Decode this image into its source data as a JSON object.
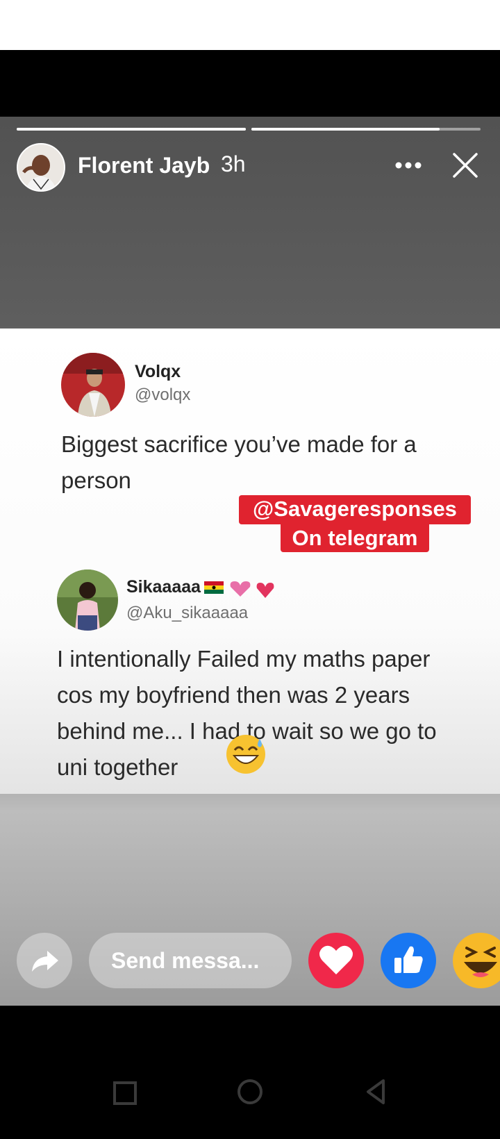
{
  "story": {
    "author": "Florent Jayb",
    "time": "3h",
    "progress": [
      1.0,
      0.82
    ]
  },
  "post": {
    "tweet1": {
      "name": "Volqx",
      "handle": "@volqx",
      "text_line1": "Biggest sacrifice you’ve made for a",
      "text_line2": "person"
    },
    "watermark": {
      "line1": "@Savageresponses",
      "line2": "On telegram"
    },
    "tweet2": {
      "name": "Sikaaaaa",
      "handle": "@Aku_sikaaaaa",
      "text_line1": "I intentionally Failed my maths paper",
      "text_line2": "cos my boyfriend then was  2 years",
      "text_line3": "behind me... I had to wait so  we go to",
      "text_line4": "uni together"
    }
  },
  "actions": {
    "message_placeholder": "Send messa...",
    "icons": [
      "share-icon",
      "heart-reaction-icon",
      "like-reaction-icon",
      "haha-reaction-icon"
    ]
  },
  "colors": {
    "heart": "#f0284a",
    "like": "#1877f2",
    "haha": "#f7b928",
    "watermark": "#e0232f"
  }
}
